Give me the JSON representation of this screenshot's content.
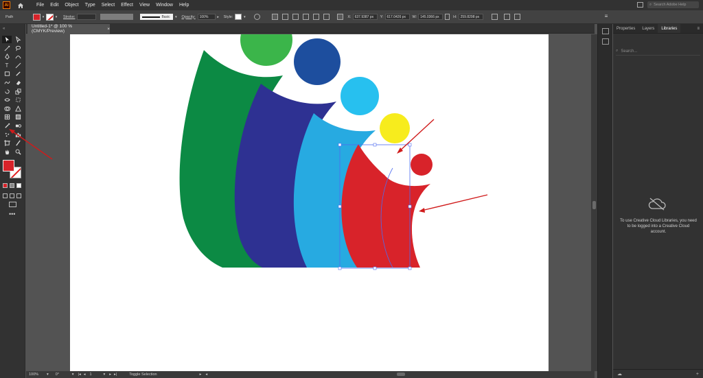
{
  "menubar": {
    "app_logo": "Ai",
    "items": [
      "File",
      "Edit",
      "Object",
      "Type",
      "Select",
      "Effect",
      "View",
      "Window",
      "Help"
    ],
    "search_placeholder": "Search Adobe Help",
    "icons": [
      "home-icon",
      "layout-icon",
      "search-icon"
    ]
  },
  "control": {
    "object_type": "Path",
    "stroke_label": "Stroke:",
    "stroke_value": "",
    "brush": "Basic",
    "opacity_label": "Opacity:",
    "opacity_value": "100%",
    "style_label": "Style:",
    "x_label": "X:",
    "x_value": "637.9387 px",
    "y_label": "Y:",
    "y_value": "617.0426 px",
    "w_label": "W:",
    "w_value": "145.0366 px",
    "h_label": "H:",
    "h_value": "259.8298 px",
    "fill_color": "#d8232a"
  },
  "document": {
    "tab_title": "Untitled-1* @ 100 % (CMYK/Preview)",
    "close": "×"
  },
  "tools": {
    "names": [
      "selection",
      "direct-selection",
      "magic-wand",
      "lasso",
      "pen",
      "curvature",
      "type",
      "line",
      "rectangle",
      "paintbrush",
      "shaper",
      "eraser",
      "rotate",
      "scale",
      "width",
      "free-transform",
      "shape-builder",
      "perspective",
      "mesh",
      "gradient",
      "eyedropper",
      "blend",
      "symbol-sprayer",
      "column-graph",
      "artboard",
      "slice",
      "hand",
      "zoom"
    ],
    "fill_color": "#d8232a",
    "more": "•••"
  },
  "status": {
    "zoom": "100%",
    "rotation": "0°",
    "artboard": "1",
    "tool_hint": "Toggle Selection"
  },
  "panel": {
    "tabs": [
      "Properties",
      "Layers",
      "Libraries"
    ],
    "active_tab": "Libraries",
    "search_placeholder": "Search...",
    "message": "To use Creative Cloud Libraries, you need to be logged into a Creative Cloud account."
  },
  "artwork": {
    "colors": {
      "green": "#0c8a44",
      "navy": "#2e3192",
      "skyblue": "#27aae1",
      "red": "#d8232a",
      "yellow": "#f7ec1d",
      "lightgreen": "#3bb54a",
      "royalblue": "#1d4e9e",
      "cyan": "#27c0ef",
      "annotation": "#d01b1b",
      "selection": "#4d6cf0"
    }
  }
}
